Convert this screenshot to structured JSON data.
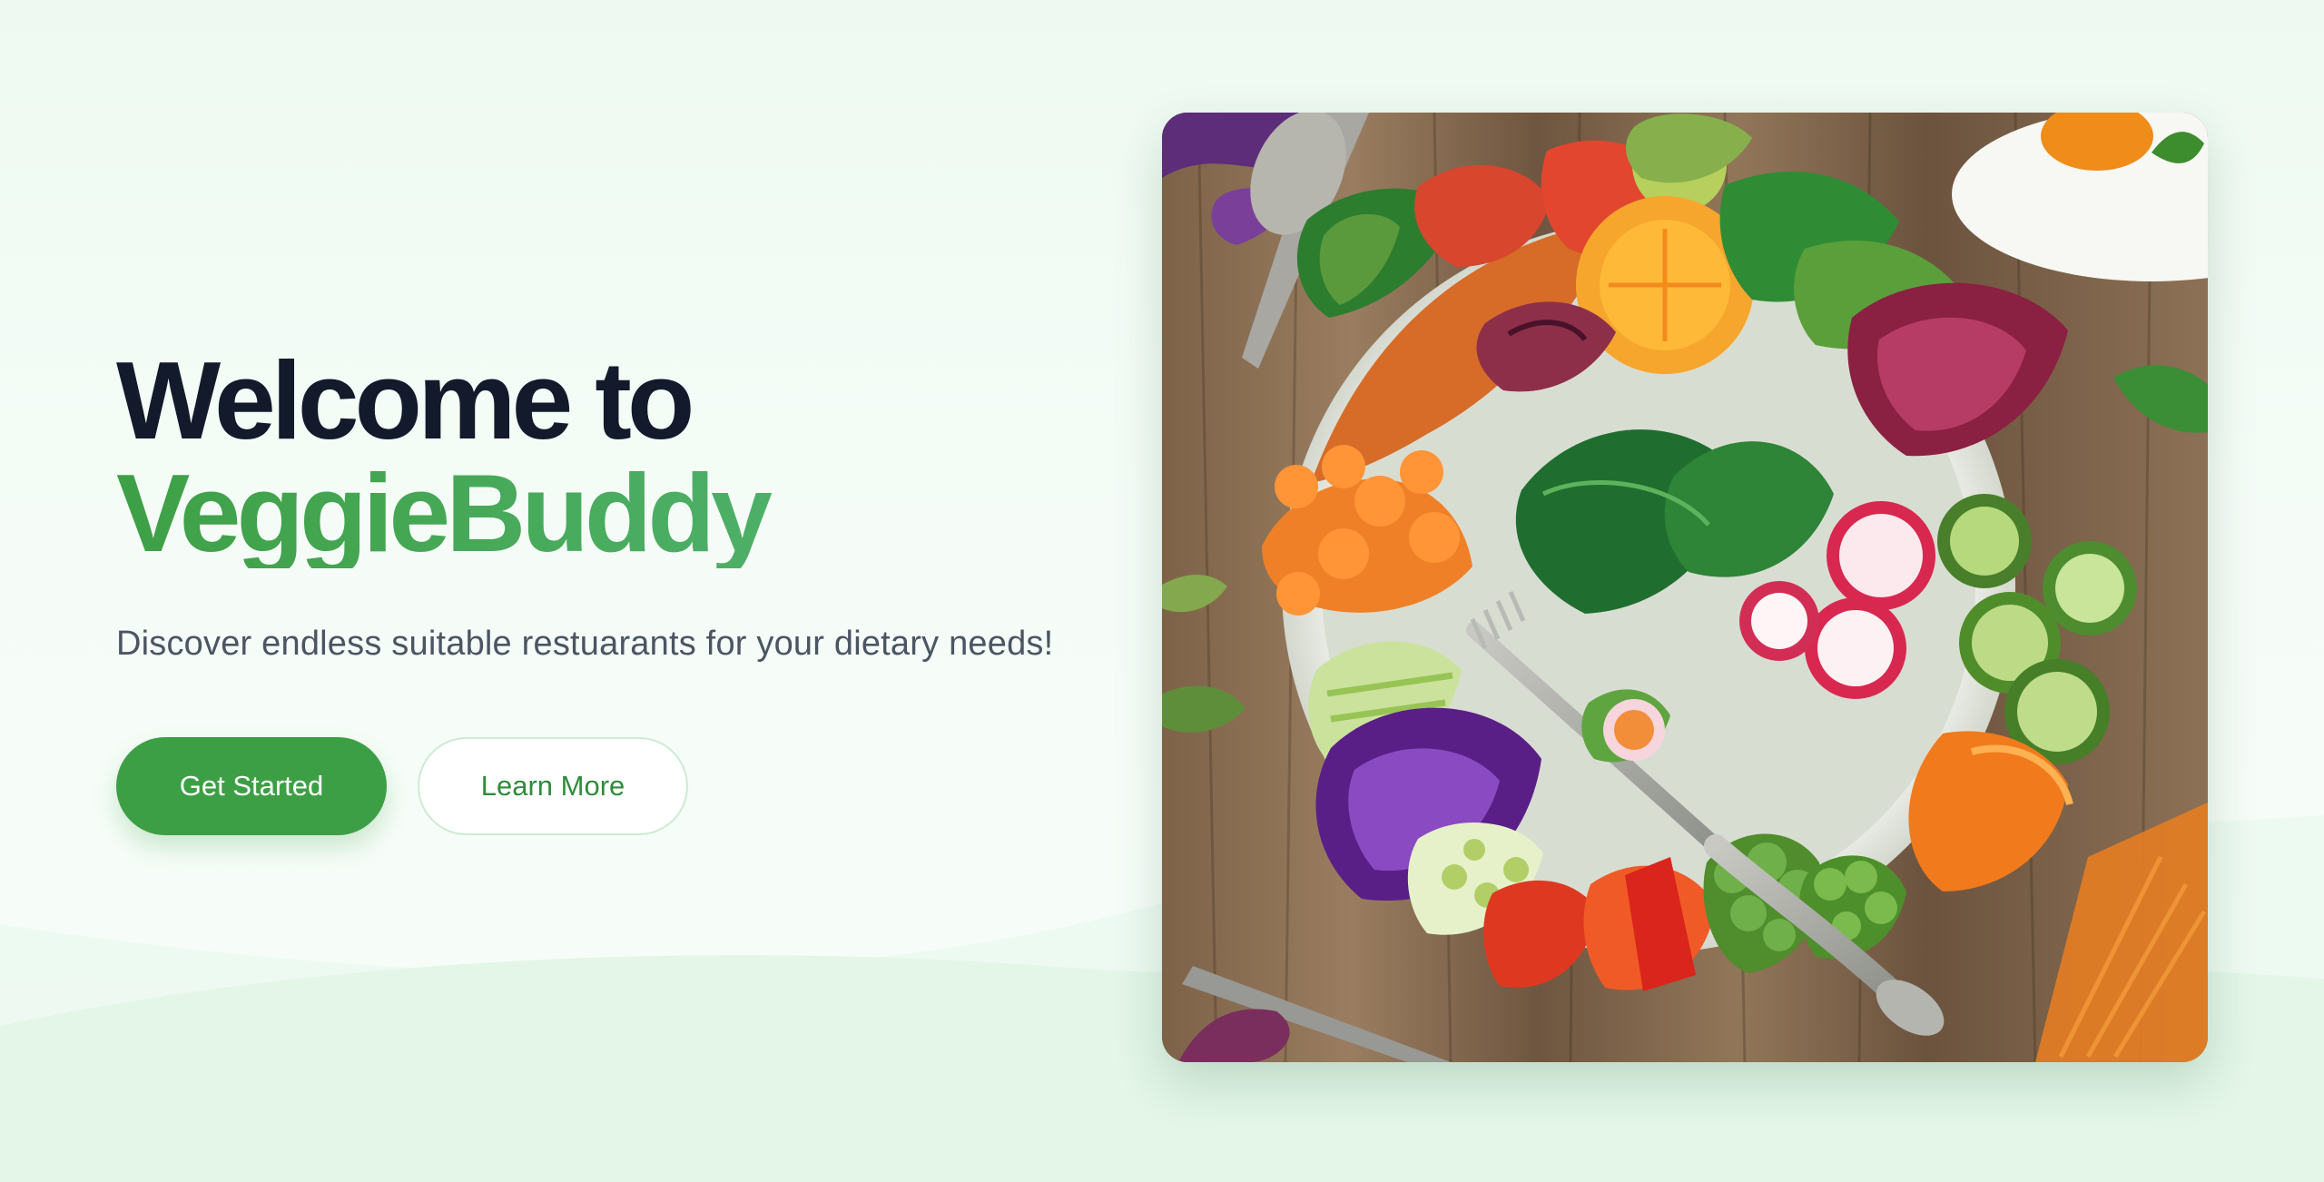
{
  "hero": {
    "title_line1": "Welcome to",
    "title_line2": "VeggieBuddy",
    "subtitle": "Discover endless suitable restuarants for your dietary needs!",
    "primary_button": "Get Started",
    "secondary_button": "Learn More"
  },
  "colors": {
    "background": "#eefaf1",
    "title_dark": "#131a2b",
    "brand_green": "#3ea045",
    "brand_green_light": "#56b87a",
    "subtitle_text": "#4b5563",
    "button_primary_bg": "#3d9f45",
    "button_secondary_text": "#2f8c3b",
    "button_secondary_border": "#cdebd3"
  }
}
